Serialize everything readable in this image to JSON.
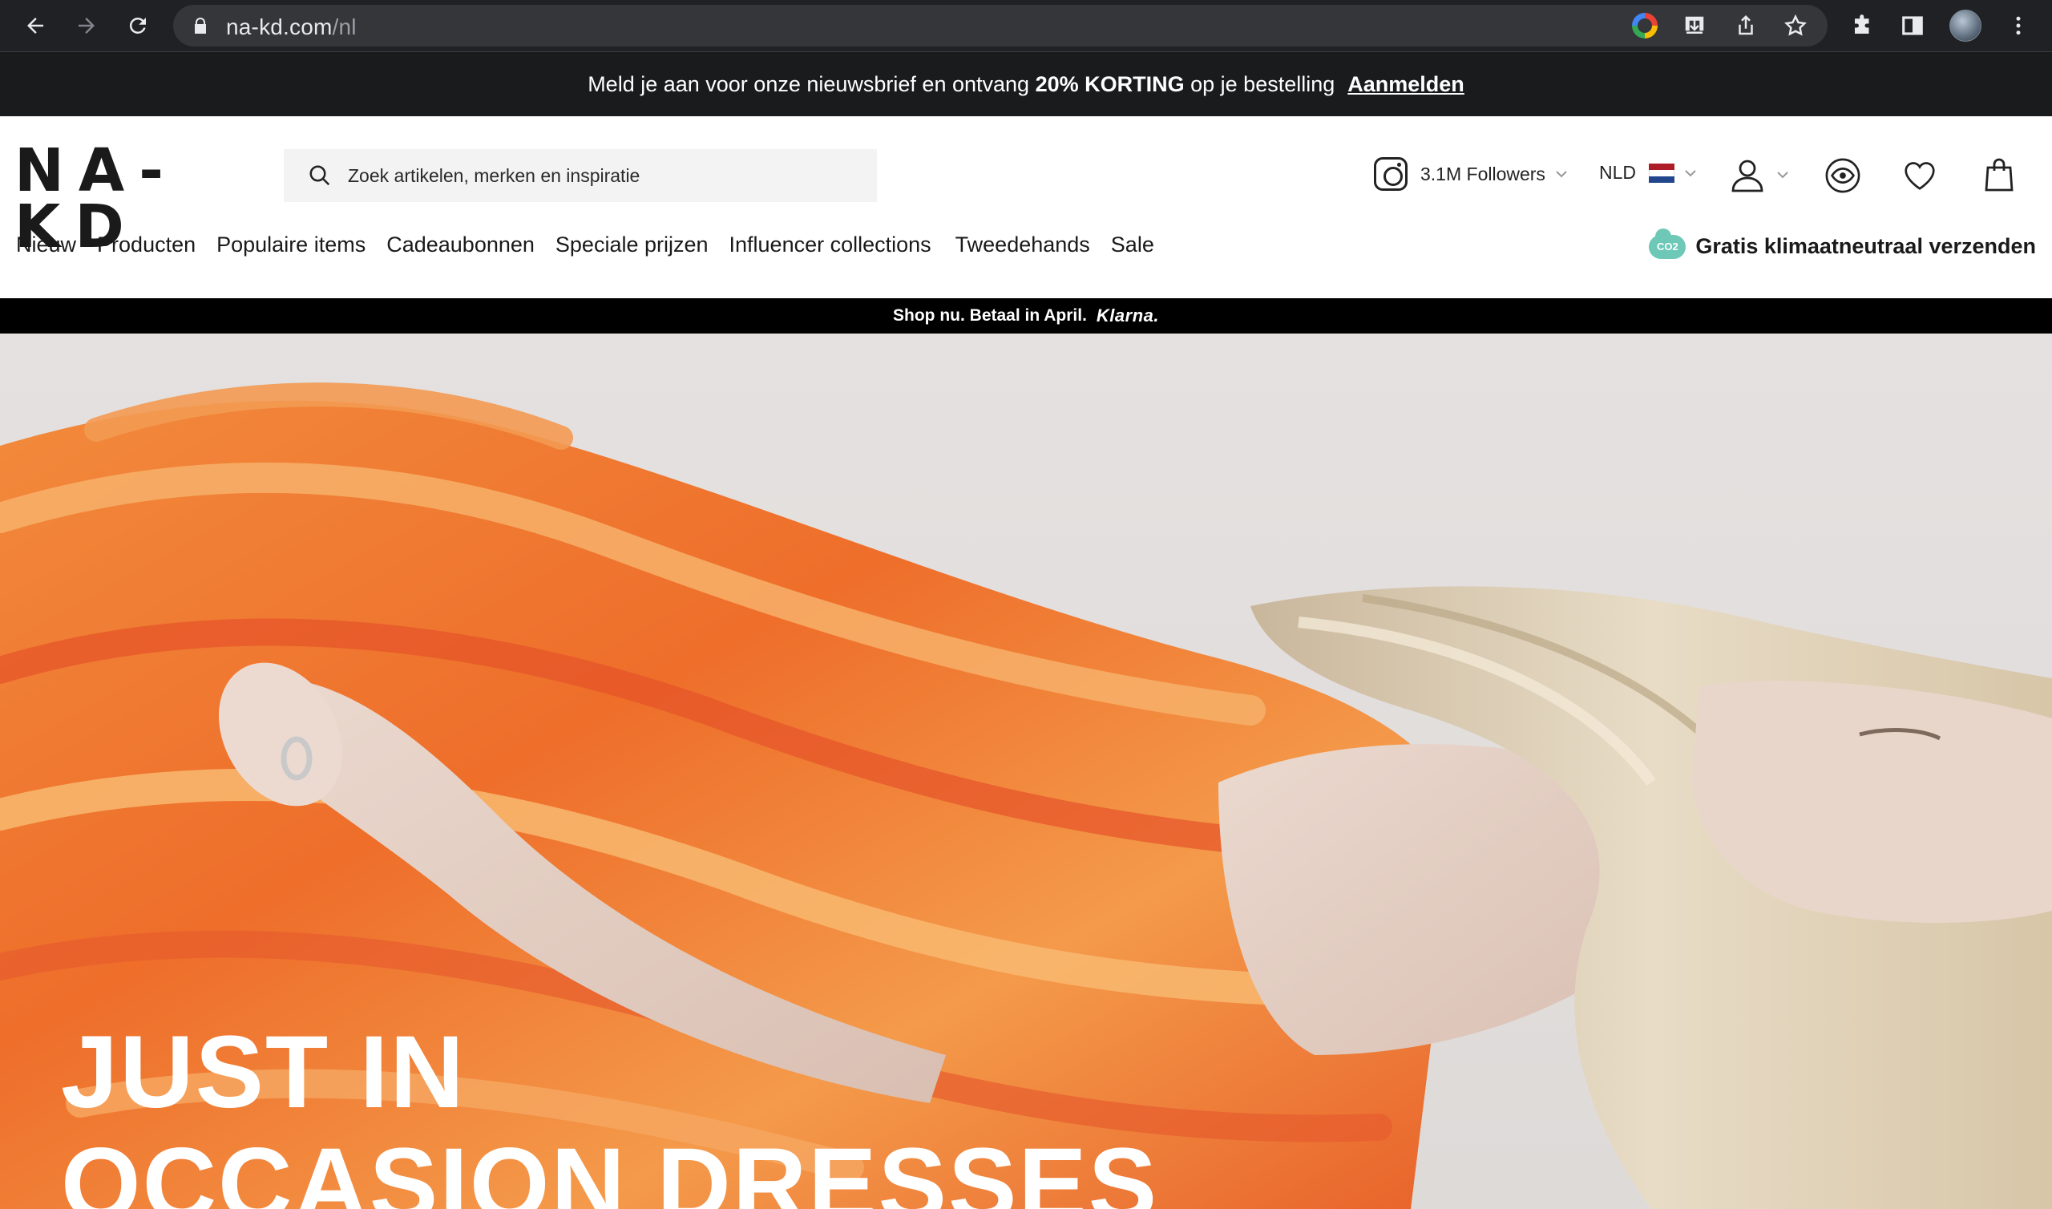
{
  "browser": {
    "url_domain": "na-kd.com",
    "url_path": "/nl"
  },
  "announcement": {
    "text_before": "Meld je aan voor onze nieuwsbrief en ontvang",
    "highlight": "20% KORTING",
    "text_after": "op je bestelling",
    "link_label": "Aanmelden"
  },
  "header": {
    "logo_text": "NA-KD",
    "search_placeholder": "Zoek artikelen, merken en inspiratie",
    "instagram_followers": "3.1M Followers",
    "language": "NLD"
  },
  "nav": {
    "categories": [
      "Nieuw",
      "Producten",
      "Populaire items",
      "Cadeaubonnen",
      "Speciale prijzen",
      "Influencer collections",
      "Tweedehands",
      "Sale"
    ],
    "climate_badge": "CO2",
    "climate_text": "Gratis klimaatneutraal verzenden"
  },
  "klarna": {
    "text": "Shop nu. Betaal in April.",
    "brand": "Klarna."
  },
  "hero": {
    "line1": "JUST IN",
    "line2": "OCCASION DRESSES"
  },
  "colors": {
    "announcement_bg": "#1a1b1d",
    "klarna_bg": "#000000",
    "dress_orange": "#f07a2c",
    "co2_badge": "#6ec8b8"
  }
}
